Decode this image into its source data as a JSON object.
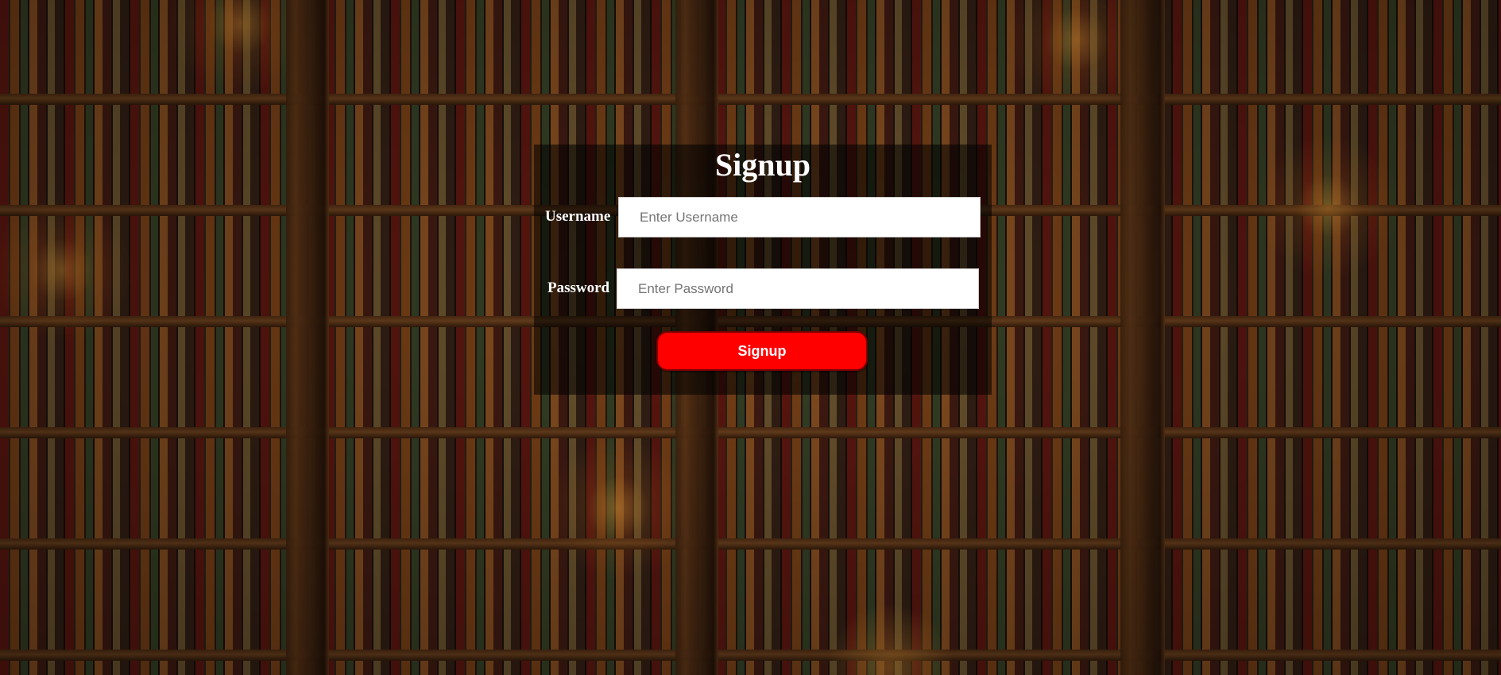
{
  "form": {
    "title": "Signup",
    "username": {
      "label": "Username",
      "placeholder": "Enter Username",
      "value": ""
    },
    "password": {
      "label": "Password",
      "placeholder": "Enter Password",
      "value": ""
    },
    "submit_label": "Signup"
  },
  "colors": {
    "submit_background": "#ff0000",
    "text": "#ffffff",
    "panel_overlay": "rgba(0,0,0,0.55)"
  }
}
